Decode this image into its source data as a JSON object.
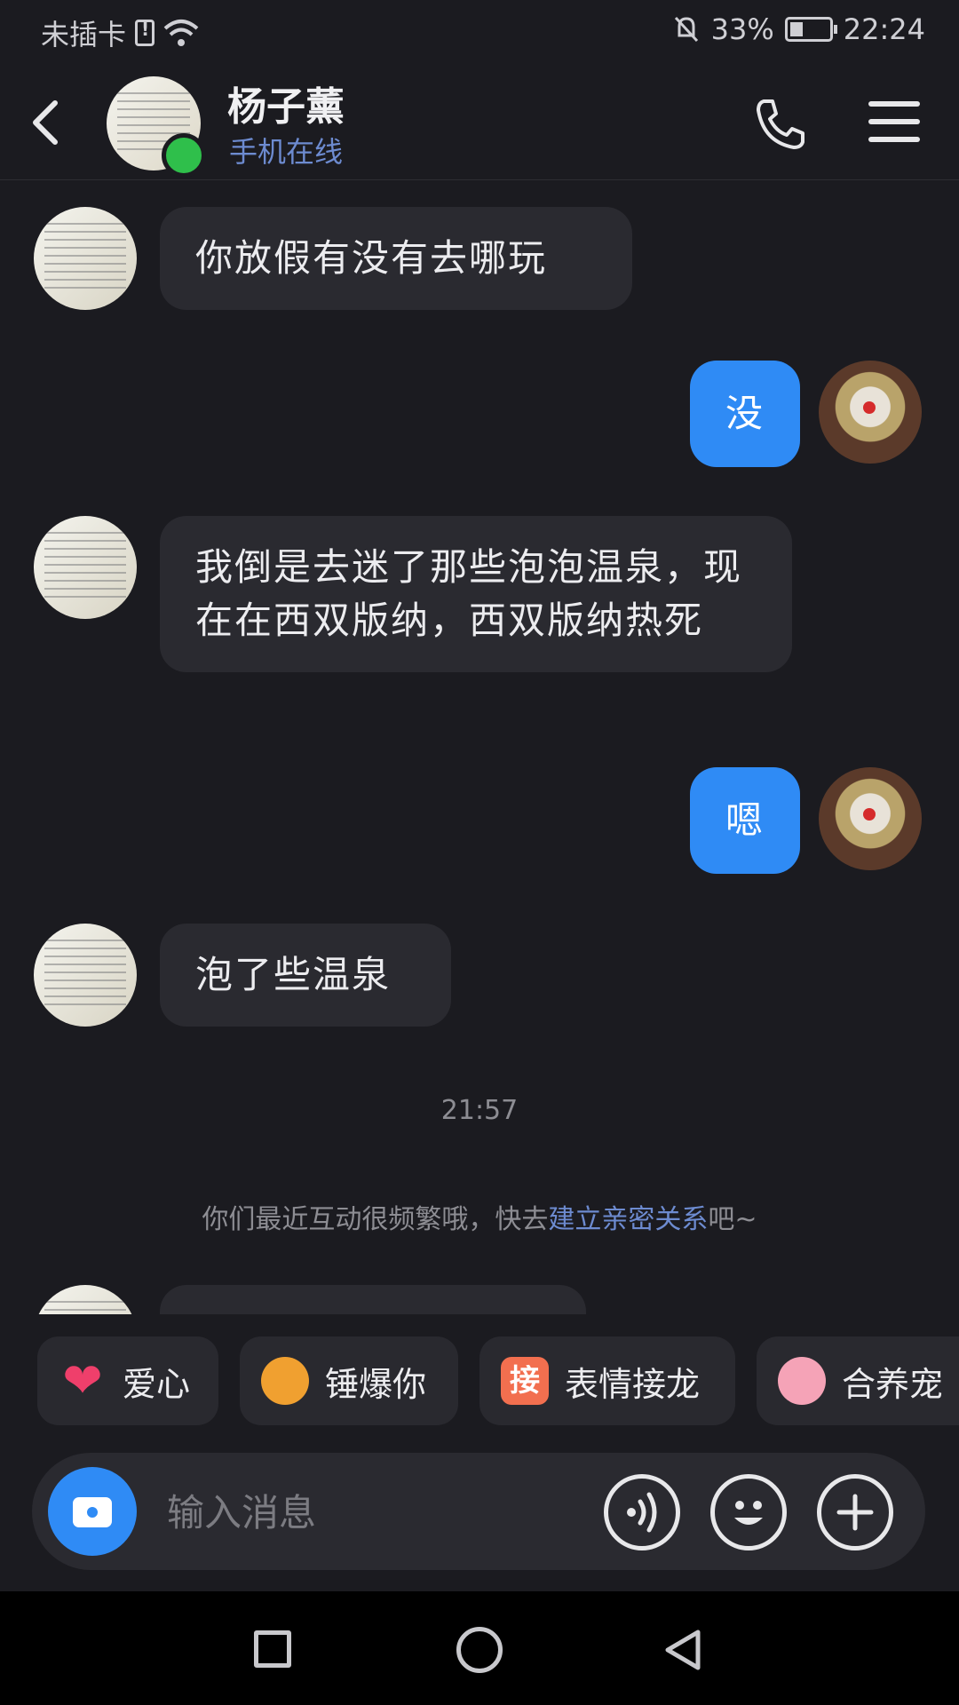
{
  "status_bar": {
    "carrier": "未插卡",
    "battery": "33%",
    "time": "22:24"
  },
  "header": {
    "contact_name": "杨子薰",
    "contact_status": "手机在线"
  },
  "messages": [
    {
      "side": "other",
      "text": "你放假有没有去哪玩"
    },
    {
      "side": "me",
      "text": "没"
    },
    {
      "side": "other",
      "text": "我倒是去迷了那些泡泡温泉，现在在西双版纳，西双版纳热死"
    },
    {
      "side": "me",
      "text": "嗯"
    },
    {
      "side": "other",
      "text": "泡了些温泉"
    }
  ],
  "time_label": "21:57",
  "hint": {
    "before": "你们最近互动很频繁哦，快去",
    "link": "建立亲密关系",
    "after": "吧~"
  },
  "quick_actions": [
    {
      "icon": "heart-icon",
      "label": "爱心"
    },
    {
      "icon": "hammer-icon",
      "label": "锤爆你"
    },
    {
      "icon": "solitaire-icon",
      "glyph": "接",
      "label": "表情接龙"
    },
    {
      "icon": "pet-icon",
      "label": "合养宠"
    }
  ],
  "input": {
    "placeholder": "输入消息"
  },
  "colors": {
    "accent": "#2f8bf5",
    "online": "#2fbf4b",
    "link": "#6d8bd0",
    "background": "#1b1b20"
  }
}
